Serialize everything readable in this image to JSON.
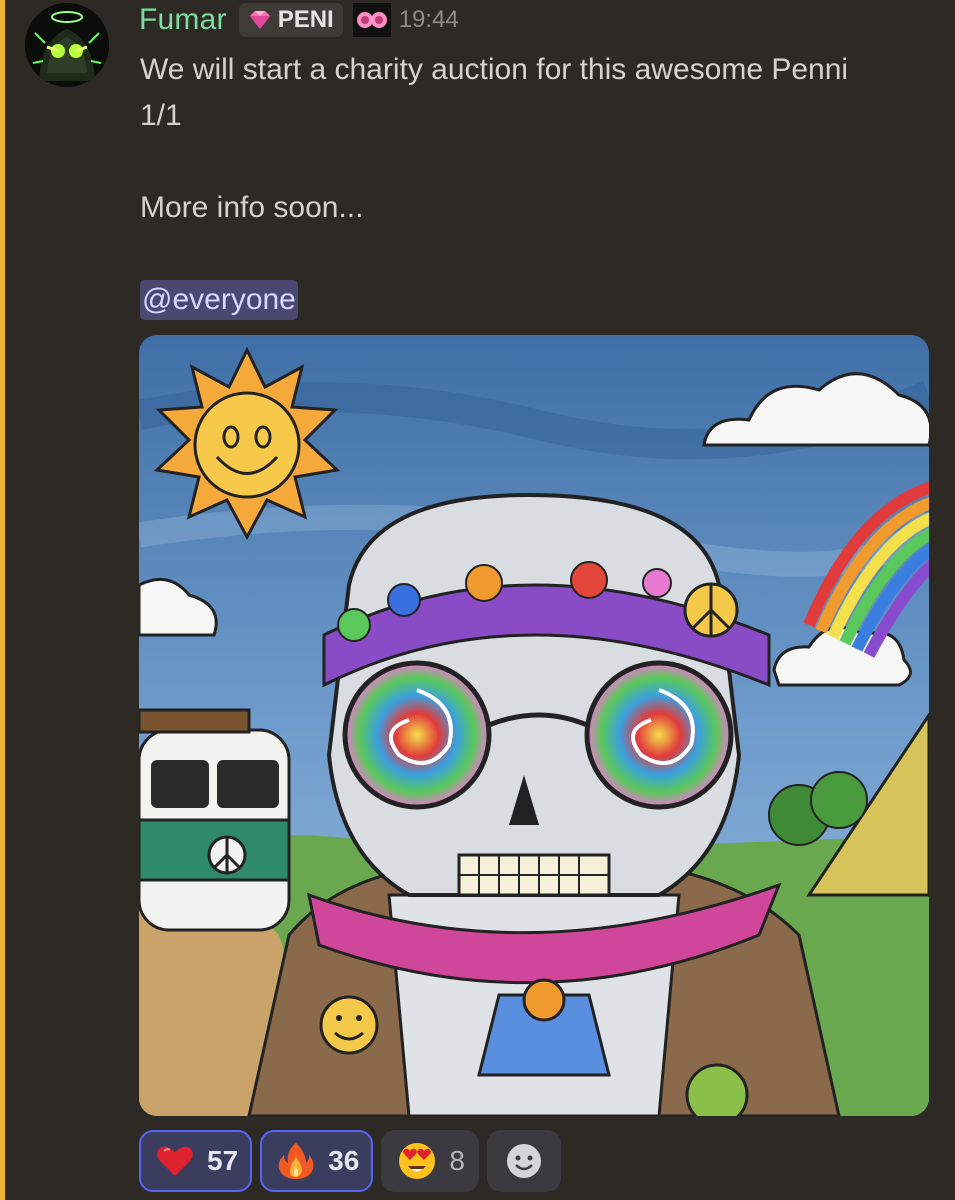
{
  "message": {
    "author": "Fumar",
    "role_tag": "PENI",
    "timestamp": "19:44",
    "lines": [
      "We will start a charity auction for this awesome Penni",
      "1/1",
      "",
      "More info soon...",
      ""
    ],
    "mention": "@everyone"
  },
  "icons": {
    "avatar": "green-hooded-figure-avatar",
    "role_icon": "pink-gem-icon",
    "server_icon": "pink-sunglasses-icon"
  },
  "attachment": {
    "subject": "hippie-skull-artwork"
  },
  "reactions": [
    {
      "emoji": "heart",
      "count": "57",
      "reacted": true
    },
    {
      "emoji": "fire",
      "count": "36",
      "reacted": true
    },
    {
      "emoji": "heart-eyes",
      "count": "8",
      "reacted": false
    }
  ],
  "colors": {
    "background": "#2d2a26",
    "mention_highlight_bar": "#f0b232",
    "username": "#7bde9c",
    "mention_bg": "#4a4873",
    "reacted_border": "#5865f2"
  }
}
